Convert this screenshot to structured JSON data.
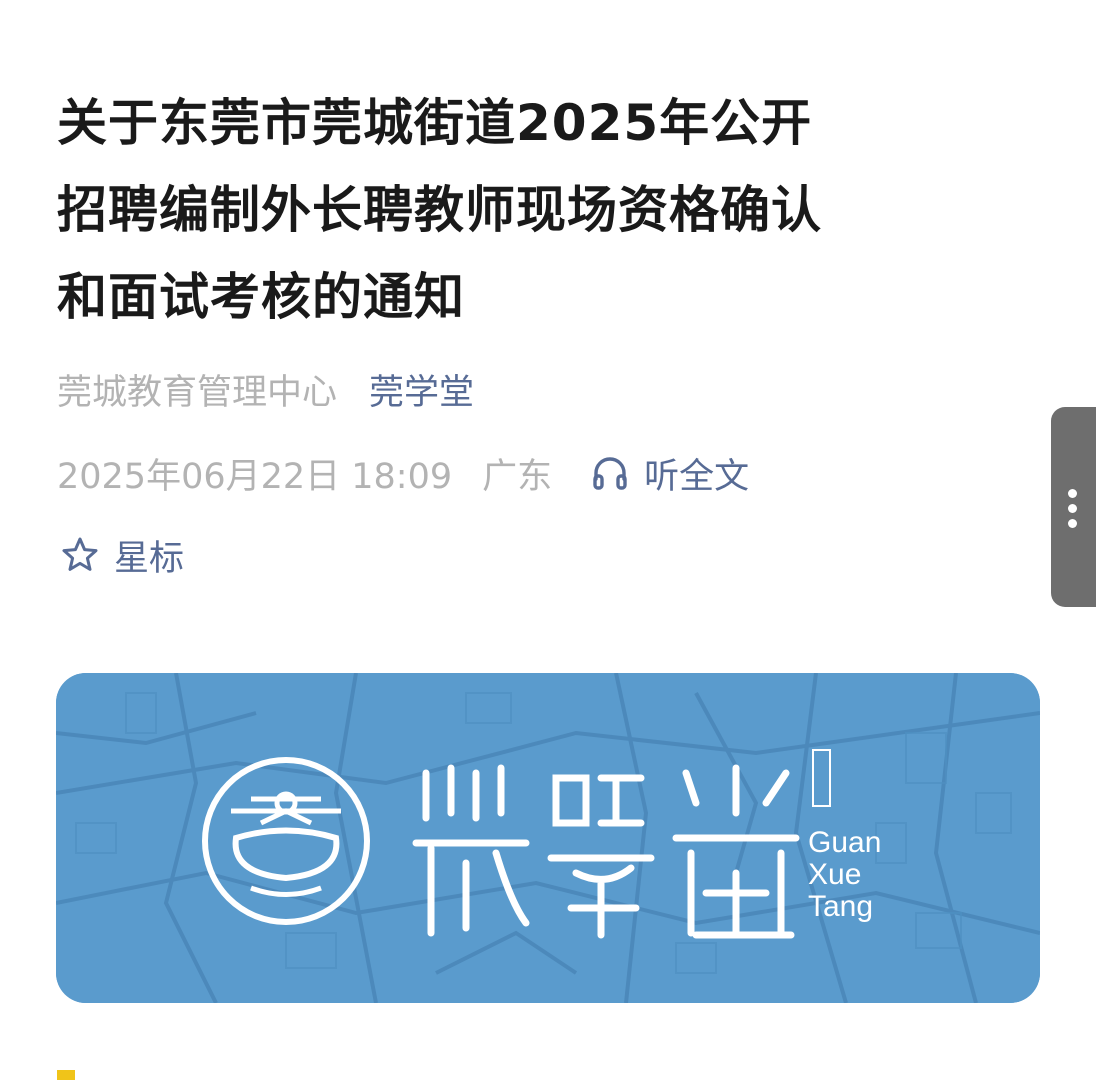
{
  "article": {
    "title_lines": [
      "关于东莞市莞城街道2025年公开",
      "招聘编制外长聘教师现场资格确认",
      "和面试考核的通知"
    ],
    "author": "莞城教育管理中心",
    "account_name": "莞学堂",
    "publish_time": "2025年06月22日 18:09",
    "region": "广东",
    "listen_label": "听全文",
    "star_label": "星标"
  },
  "banner": {
    "brand_latin": [
      "Guan",
      "Xue",
      "Tang"
    ],
    "background_color": "#5a9bcd"
  },
  "icons": {
    "listen": "headphones-icon",
    "star": "star-outline-icon",
    "more": "more-vertical-icon"
  },
  "colors": {
    "title": "#1a1a1a",
    "meta_gray": "#b3b3b3",
    "link_blue": "#576b95",
    "accent_yellow": "#f0c419"
  }
}
